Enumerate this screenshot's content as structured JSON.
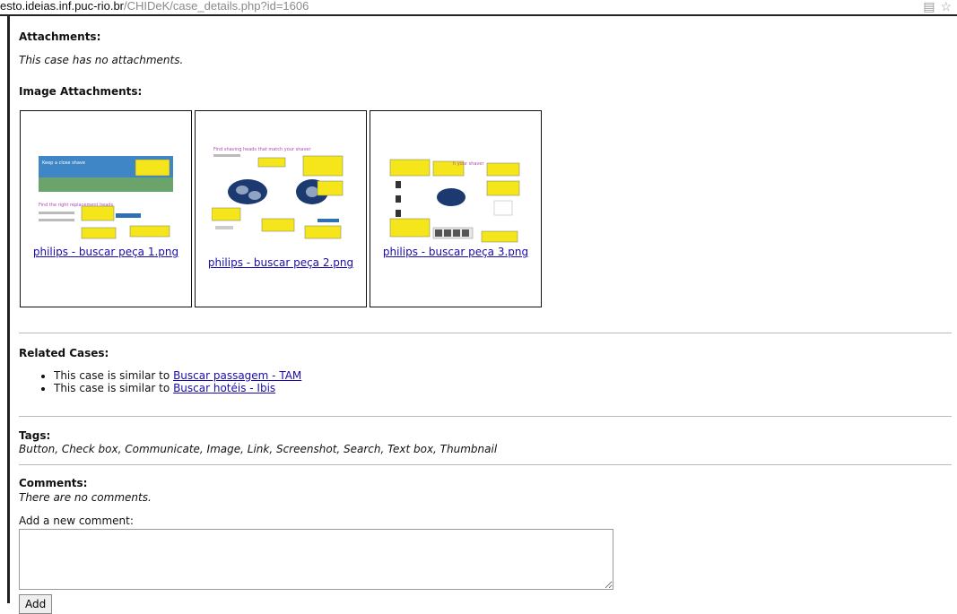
{
  "browser": {
    "url_host": "esto.ideias.inf.puc-rio.br",
    "url_path": "/CHIDeK/case_details.php?id=1606"
  },
  "attachments": {
    "label": "Attachments:",
    "empty_text": "This case has no attachments."
  },
  "image_attachments": {
    "label": "Image Attachments:",
    "items": [
      {
        "link": "philips - buscar peça 1.png"
      },
      {
        "link": "philips - buscar peça 2.png"
      },
      {
        "link": "philips - buscar peça 3.png"
      }
    ]
  },
  "related_cases": {
    "label": "Related Cases:",
    "items": [
      {
        "prefix": "This case is similar to",
        "link": "Buscar passagem - TAM"
      },
      {
        "prefix": "This case is similar to",
        "link": "Buscar hotéis - Ibis"
      }
    ]
  },
  "tags": {
    "label": "Tags:",
    "value": "Button, Check box, Communicate, Image, Link, Screenshot, Search, Text box, Thumbnail"
  },
  "comments": {
    "label": "Comments:",
    "empty_text": "There are no comments.",
    "add_label": "Add a new comment:",
    "textarea_value": "",
    "add_button": "Add"
  },
  "colors": {
    "link": "#1a0dab",
    "callout": "#f5e61b",
    "separator": "#bbbbbb"
  }
}
